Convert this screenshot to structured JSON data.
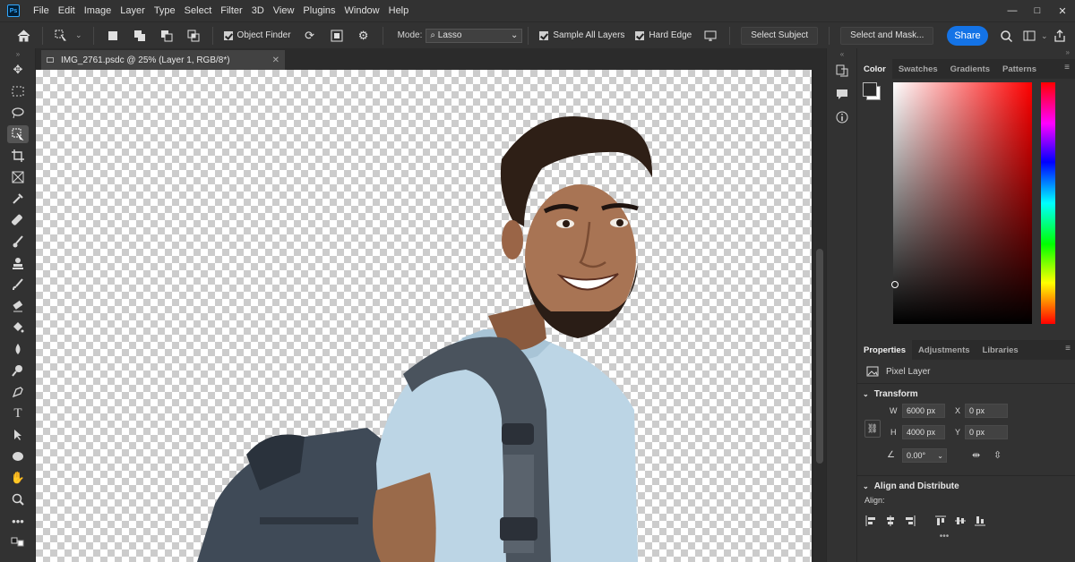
{
  "app": {
    "logo": "Ps"
  },
  "menu": [
    "File",
    "Edit",
    "Image",
    "Layer",
    "Type",
    "Select",
    "Filter",
    "3D",
    "View",
    "Plugins",
    "Window",
    "Help"
  ],
  "window_controls": {
    "minimize": "—",
    "maximize": "□",
    "close": "✕"
  },
  "options": {
    "object_finder": "Object Finder",
    "mode_label": "Mode:",
    "mode_value": "Lasso",
    "sample_all_layers": "Sample All Layers",
    "hard_edge": "Hard Edge",
    "select_subject": "Select Subject",
    "select_and_mask": "Select and Mask...",
    "share": "Share"
  },
  "document": {
    "tab_title": "IMG_2761.psdc @ 25% (Layer 1, RGB/8*)"
  },
  "color_panel": {
    "tabs": [
      "Color",
      "Swatches",
      "Gradients",
      "Patterns"
    ],
    "active_tab": "Color",
    "foreground": "#2a2a2a",
    "background": "#ffffff"
  },
  "properties_panel": {
    "tabs": [
      "Properties",
      "Adjustments",
      "Libraries"
    ],
    "layer_type": "Pixel Layer",
    "transform_title": "Transform",
    "w_label": "W",
    "w_value": "6000 px",
    "h_label": "H",
    "h_value": "4000 px",
    "x_label": "X",
    "x_value": "0 px",
    "y_label": "Y",
    "y_value": "0 px",
    "angle_value": "0.00°",
    "align_title": "Align and Distribute",
    "align_label": "Align:"
  },
  "colors": {
    "accent": "#1473e6",
    "ui_dark": "#323232",
    "ui_mid": "#535353"
  }
}
